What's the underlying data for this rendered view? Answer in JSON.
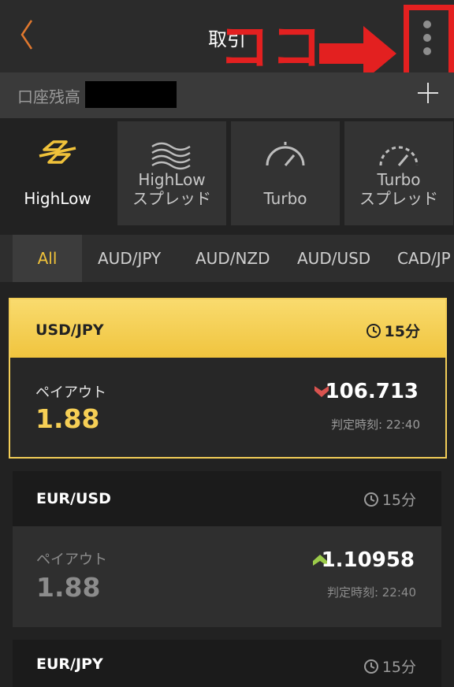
{
  "header": {
    "title": "取引"
  },
  "annotation": {
    "text": "ココ",
    "color": "#e32020"
  },
  "balance": {
    "label": "口座残高"
  },
  "trade_types": [
    {
      "label": "HighLow",
      "icon": "highlow-icon",
      "active": true
    },
    {
      "label_lines": [
        "HighLow",
        "スプレッド"
      ],
      "icon": "highlow-spread-icon"
    },
    {
      "label": "Turbo",
      "icon": "speedometer-icon"
    },
    {
      "label_lines": [
        "Turbo",
        "スプレッド"
      ],
      "icon": "turbo-spread-icon"
    }
  ],
  "filter_tabs": [
    "All",
    "AUD/JPY",
    "AUD/NZD",
    "AUD/USD",
    "CAD/JP"
  ],
  "cards": [
    {
      "pair": "USD/JPY",
      "duration": "15分",
      "payout_label": "ペイアウト",
      "payout": "1.88",
      "rate": "106.713",
      "direction": "down",
      "judgment": "判定時刻: 22:40"
    },
    {
      "pair": "EUR/USD",
      "duration": "15分",
      "payout_label": "ペイアウト",
      "payout": "1.88",
      "rate": "1.10958",
      "direction": "up",
      "judgment": "判定時刻: 22:40"
    },
    {
      "pair": "EUR/JPY",
      "duration": "15分"
    }
  ],
  "colors": {
    "accent": "#f0c23a",
    "down": "#d9534f",
    "up": "#9ccc4a"
  }
}
